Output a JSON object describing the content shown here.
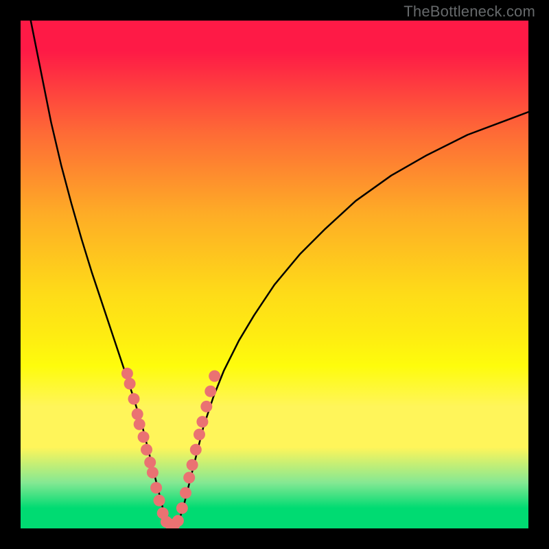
{
  "watermark": {
    "text": "TheBottleneck.com"
  },
  "chart_data": {
    "type": "line",
    "title": "",
    "xlabel": "",
    "ylabel": "",
    "xlim": [
      0,
      100
    ],
    "ylim": [
      0,
      100
    ],
    "grid": false,
    "legend": false,
    "series": [
      {
        "name": "left-curve",
        "x": [
          2,
          4,
          6,
          8,
          10,
          12,
          14,
          16,
          18,
          20,
          22,
          24,
          25,
          26,
          27,
          28,
          28.5
        ],
        "y": [
          100,
          90,
          80,
          71.5,
          64,
          57,
          50.5,
          44.5,
          38.5,
          32.5,
          26.5,
          20,
          16,
          12,
          8,
          4,
          1
        ]
      },
      {
        "name": "right-curve",
        "x": [
          31,
          32,
          33,
          34,
          35,
          36,
          38,
          40,
          43,
          46,
          50,
          55,
          60,
          66,
          73,
          80,
          88,
          96,
          100
        ],
        "y": [
          1,
          4,
          8,
          12,
          16,
          20,
          26,
          31,
          37,
          42,
          48,
          54,
          59,
          64.5,
          69.5,
          73.5,
          77.5,
          80.5,
          82
        ]
      },
      {
        "name": "bottom-arc",
        "x": [
          28.5,
          29,
          30,
          31
        ],
        "y": [
          1,
          0.6,
          0.6,
          1
        ]
      }
    ],
    "highlight_points": {
      "name": "highlight-dots",
      "color": "#ea7272",
      "points": [
        {
          "x": 21.0,
          "y": 30.5
        },
        {
          "x": 21.5,
          "y": 28.5
        },
        {
          "x": 22.3,
          "y": 25.5
        },
        {
          "x": 23.0,
          "y": 22.5
        },
        {
          "x": 23.4,
          "y": 20.5
        },
        {
          "x": 24.2,
          "y": 18.0
        },
        {
          "x": 24.8,
          "y": 15.5
        },
        {
          "x": 25.5,
          "y": 13.0
        },
        {
          "x": 26.0,
          "y": 11.0
        },
        {
          "x": 26.7,
          "y": 8.0
        },
        {
          "x": 27.3,
          "y": 5.5
        },
        {
          "x": 28.0,
          "y": 3.0
        },
        {
          "x": 28.7,
          "y": 1.3
        },
        {
          "x": 29.5,
          "y": 0.8
        },
        {
          "x": 30.3,
          "y": 0.8
        },
        {
          "x": 31.0,
          "y": 1.5
        },
        {
          "x": 31.8,
          "y": 4.0
        },
        {
          "x": 32.5,
          "y": 7.0
        },
        {
          "x": 33.2,
          "y": 10.0
        },
        {
          "x": 33.8,
          "y": 12.5
        },
        {
          "x": 34.5,
          "y": 15.5
        },
        {
          "x": 35.2,
          "y": 18.5
        },
        {
          "x": 35.8,
          "y": 21.0
        },
        {
          "x": 36.6,
          "y": 24.0
        },
        {
          "x": 37.4,
          "y": 27.0
        },
        {
          "x": 38.2,
          "y": 30.0
        }
      ]
    },
    "background_gradient": {
      "type": "vertical",
      "stops": [
        {
          "y": 100,
          "color": "#fe1a46"
        },
        {
          "y": 70,
          "color": "#fe8b2e"
        },
        {
          "y": 40,
          "color": "#fedc18"
        },
        {
          "y": 20,
          "color": "#fff55a"
        },
        {
          "y": 6,
          "color": "#84e893"
        },
        {
          "y": 0,
          "color": "#00db72"
        }
      ]
    }
  }
}
